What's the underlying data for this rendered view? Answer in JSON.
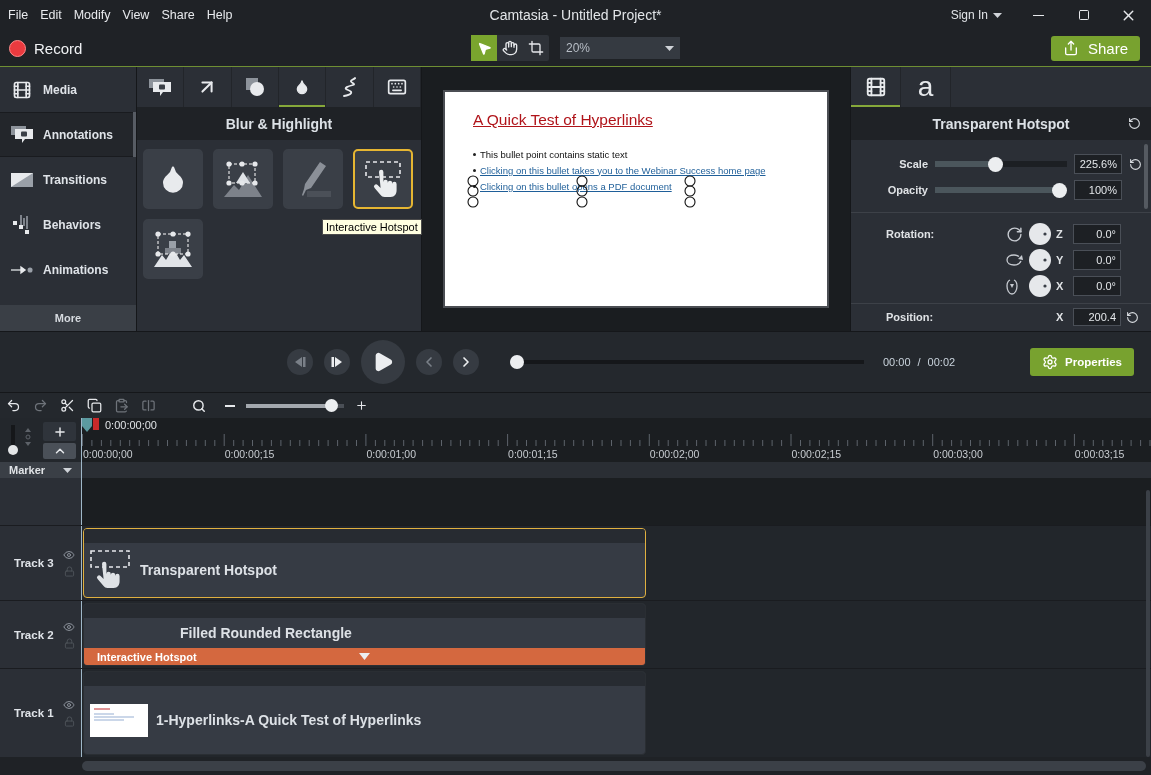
{
  "window": {
    "menu": [
      "File",
      "Edit",
      "Modify",
      "View",
      "Share",
      "Help"
    ],
    "title": "Camtasia - Untitled Project*",
    "sign_in": "Sign In"
  },
  "toolbar": {
    "record": "Record",
    "tools": [
      {
        "kind": "select",
        "selected": true
      },
      {
        "kind": "pan",
        "selected": false
      },
      {
        "kind": "crop",
        "selected": false
      }
    ],
    "zoom": "20%",
    "share": "Share"
  },
  "sidebar": {
    "items": [
      {
        "kind": "media",
        "label": "Media",
        "selected": false
      },
      {
        "kind": "annotations",
        "label": "Annotations",
        "selected": true
      },
      {
        "kind": "transitions",
        "label": "Transitions",
        "selected": false
      },
      {
        "kind": "behaviors",
        "label": "Behaviors",
        "selected": false
      },
      {
        "kind": "animations",
        "label": "Animations",
        "selected": false
      }
    ],
    "more": "More"
  },
  "annotations_panel": {
    "tabs": [
      {
        "kind": "callout",
        "selected": false
      },
      {
        "kind": "arrow",
        "selected": false
      },
      {
        "kind": "shape",
        "selected": false
      },
      {
        "kind": "blur",
        "selected": true
      },
      {
        "kind": "sketch",
        "selected": false
      },
      {
        "kind": "keystroke",
        "selected": false
      }
    ],
    "heading": "Blur & Highlight",
    "items": [
      {
        "kind": "blur",
        "selected": false
      },
      {
        "kind": "spotlight",
        "selected": false
      },
      {
        "kind": "highlight",
        "selected": false
      },
      {
        "kind": "hotspot",
        "selected": true
      },
      {
        "kind": "pixelate",
        "selected": false
      }
    ],
    "tooltip": "Interactive Hotspot"
  },
  "canvas": {
    "slide": {
      "title": "A Quick Test of Hyperlinks",
      "bullets": [
        {
          "kind": "text",
          "text": "This bullet point contains static text"
        },
        {
          "kind": "link",
          "text": "Clicking on this bullet takes you to the Webinar Success home page"
        },
        {
          "kind": "link",
          "text": "Clicking on this bullet opens a PDF document"
        }
      ]
    }
  },
  "properties": {
    "tabs": [
      {
        "kind": "visual",
        "selected": true
      },
      {
        "kind": "text",
        "label": "a",
        "selected": false
      }
    ],
    "heading": "Transparent Hotspot",
    "sliders": [
      {
        "label": "Scale",
        "level": 0.45,
        "value": "225.6%",
        "reset": true
      },
      {
        "label": "Opacity",
        "level": 1,
        "value": "100%",
        "reset": false
      }
    ],
    "rotation": {
      "label": "Rotation:",
      "axes": [
        {
          "kind": "z",
          "axis": "Z",
          "value": "0.0°"
        },
        {
          "kind": "y",
          "axis": "Y",
          "value": "0.0°"
        },
        {
          "kind": "x",
          "axis": "X",
          "value": "0.0°"
        }
      ]
    },
    "position": {
      "label": "Position:",
      "axis": "X",
      "value": "200.4"
    }
  },
  "playback": {
    "buttons": [
      {
        "kind": "step_back",
        "disabled": true
      },
      {
        "kind": "step_forward",
        "disabled": false
      },
      {
        "kind": "play",
        "disabled": false
      },
      {
        "kind": "previous",
        "disabled": true
      },
      {
        "kind": "next",
        "disabled": false
      }
    ],
    "scrubber": {
      "level": 0
    },
    "current": "00:00",
    "separator": "/",
    "duration": "00:02",
    "properties": "Properties"
  },
  "timeline_toolbar": {
    "tools": [
      {
        "kind": "undo",
        "disabled": false
      },
      {
        "kind": "redo",
        "disabled": true
      },
      {
        "kind": "cut",
        "disabled": false
      },
      {
        "kind": "copy",
        "disabled": false
      },
      {
        "kind": "paste",
        "disabled": true
      },
      {
        "kind": "split",
        "disabled": true
      }
    ],
    "zoom_slider": {
      "level": 0.93
    }
  },
  "timeline": {
    "track_height": {
      "level": 0
    },
    "playhead": "0:00:00;00",
    "ruler": [
      "0:00:00;00",
      "0:00:00;15",
      "0:00:01;00",
      "0:00:01;15",
      "0:00:02;00",
      "0:00:02;15",
      "0:00:03;00",
      "0:00:03;15"
    ],
    "marker": "Marker",
    "tracks": [
      {
        "label": "Track 3",
        "clip": {
          "kind": "hotspot",
          "title": "Transparent Hotspot",
          "selected": true
        }
      },
      {
        "label": "Track 2",
        "clip": {
          "kind": "shape",
          "title": "Filled Rounded Rectangle",
          "selected": false,
          "interactivity": "Interactive Hotspot"
        }
      },
      {
        "label": "Track 1",
        "clip": {
          "kind": "media",
          "title": "1-Hyperlinks-A Quick Test of Hyperlinks",
          "selected": false
        }
      }
    ]
  }
}
